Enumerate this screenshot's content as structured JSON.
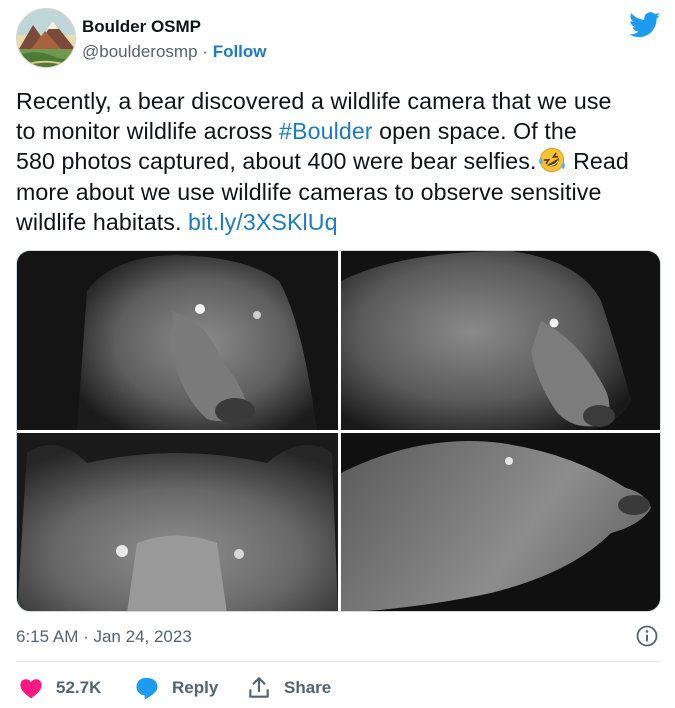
{
  "account": {
    "display_name": "Boulder OSMP",
    "handle": "@boulderosmp",
    "separator": "·",
    "follow_label": "Follow"
  },
  "tweet": {
    "line1": "Recently, a bear discovered a wildlife camera that we use",
    "line2_pre": "to monitor wildlife across ",
    "hashtag": "#Boulder",
    "line2_post": " open space. Of the",
    "line3_pre": "580 photos captured, about 400 were bear selfies.",
    "line3_post": " Read",
    "line4": "more about we use wildlife cameras to observe sensitive",
    "line5_pre": "wildlife habitats. ",
    "link": "bit.ly/3XSKlUq"
  },
  "media": {
    "photos": [
      "bear-selfie-1",
      "bear-selfie-2",
      "bear-selfie-3",
      "bear-selfie-4"
    ]
  },
  "meta": {
    "timestamp": "6:15 AM · Jan 24, 2023"
  },
  "actions": {
    "likes": "52.7K",
    "reply_label": "Reply",
    "share_label": "Share"
  },
  "colors": {
    "link": "#1d7bc4",
    "like": "#f91880",
    "reply": "#1d9bf0",
    "twitter": "#1d9bf0",
    "muted": "#536471"
  },
  "icons": [
    "twitter-bird-icon",
    "rolling-laughing-emoji",
    "info-icon",
    "heart-icon",
    "reply-bubble-icon",
    "share-icon"
  ]
}
